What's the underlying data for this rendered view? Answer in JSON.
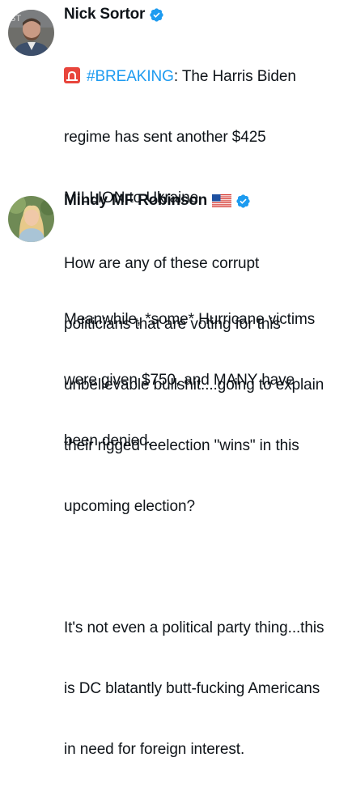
{
  "posts": [
    {
      "author": "Nick Sortor",
      "verified_icon": "verified-badge-icon",
      "lines": [
        {
          "pre": "",
          "hashtag": "#BREAKING",
          "text": ": The Harris Biden"
        },
        {
          "text": "regime has sent another $425"
        },
        {
          "text": "MILLION to Ukraine"
        },
        {
          "text": ""
        },
        {
          "text": "Meanwhile, *some* Hurricane victims"
        },
        {
          "text": "were given $750, and MANY have"
        },
        {
          "text": "been denied."
        }
      ],
      "emoji_icon": "siren-emoji-icon"
    },
    {
      "author": "Mindy MF Robinson",
      "flag_icon": "us-flag-emoji-icon",
      "verified_icon": "verified-badge-icon",
      "lines": [
        {
          "text": "How are any of these corrupt"
        },
        {
          "text": "politicians that are voting for this"
        },
        {
          "text": "unbelievable bullshit....going to explain"
        },
        {
          "text": "their rigged reelection \"wins\" in this"
        },
        {
          "text": "upcoming election?"
        },
        {
          "text": ""
        },
        {
          "text": "It's not even a political party thing...this"
        },
        {
          "text": "is DC blatantly butt-fucking Americans"
        },
        {
          "text": "in need for foreign interest."
        }
      ]
    }
  ],
  "colors": {
    "text": "#0f1419",
    "link": "#1d9bf0",
    "verified": "#1d9bf0"
  }
}
